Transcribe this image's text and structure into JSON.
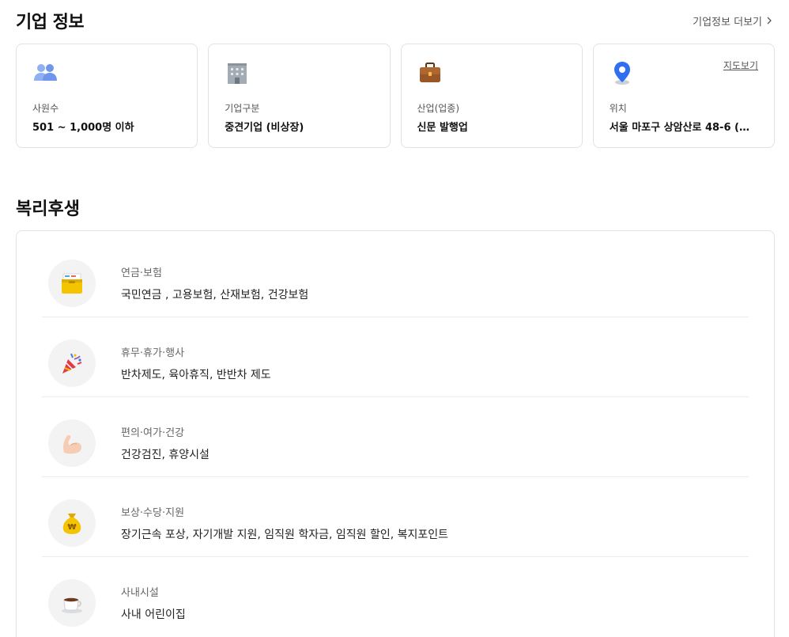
{
  "company_info": {
    "title": "기업 정보",
    "more_label": "기업정보 더보기",
    "cards": [
      {
        "icon": "people-icon",
        "label": "사원수",
        "value": "501 ~ 1,000명 이하"
      },
      {
        "icon": "building-icon",
        "label": "기업구분",
        "value": "중견기업 (비상장)"
      },
      {
        "icon": "briefcase-icon",
        "label": "산업(업종)",
        "value": "신문 발행업"
      },
      {
        "icon": "location-pin-icon",
        "label": "위치",
        "value": "서울 마포구 상암산로 48-6 (상...",
        "map_label": "지도보기"
      }
    ]
  },
  "benefits": {
    "title": "복리후생",
    "rows": [
      {
        "icon": "folder-box-icon",
        "category": "연금·보험",
        "items": "국민연금 , 고용보험, 산재보험, 건강보험"
      },
      {
        "icon": "party-popper-icon",
        "category": "휴무·휴가·행사",
        "items": "반차제도, 육아휴직, 반반차 제도"
      },
      {
        "icon": "flexed-arm-icon",
        "category": "편의·여가·건강",
        "items": "건강검진, 휴양시설"
      },
      {
        "icon": "money-bag-icon",
        "category": "보상·수당·지원",
        "items": "장기근속 포상, 자기개발 지원, 임직원 학자금, 임직원 할인, 복지포인트"
      },
      {
        "icon": "coffee-cup-icon",
        "category": "사내시설",
        "items": "사내 어린이집"
      }
    ]
  },
  "colors": {
    "accent_blue": "#3a7bf0",
    "people_blue": "#7fa3f0",
    "building_gray": "#9aa3ad",
    "briefcase_brown": "#8a4a1f",
    "folder_yellow": "#f5c400",
    "border": "#e2e2e2"
  }
}
